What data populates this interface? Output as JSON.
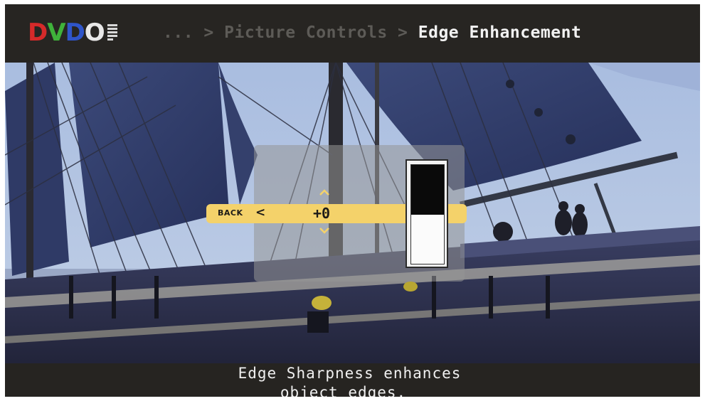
{
  "header": {
    "logo": {
      "letters": [
        {
          "char": "D",
          "color": "#d62a2a"
        },
        {
          "char": "V",
          "color": "#3fb23b"
        },
        {
          "char": "D",
          "color": "#2f55c9"
        },
        {
          "char": "O",
          "color": "#e8e8e8"
        }
      ],
      "glyph_icon": "dvdo-mark-icon"
    },
    "breadcrumb": {
      "ellipsis": "...",
      "sep1": ">",
      "parent": "Picture Controls",
      "sep2": ">",
      "current": "Edge Enhancement"
    }
  },
  "control": {
    "back_label": "BACK",
    "back_icon": "chevron-left-icon",
    "value": "+0",
    "up_icon": "chevron-up-icon",
    "down_icon": "chevron-down-icon",
    "level_fraction": 0.5,
    "accent_color": "#f4d26a"
  },
  "description": {
    "line1": "Edge Sharpness enhances",
    "line2": "object edges."
  }
}
